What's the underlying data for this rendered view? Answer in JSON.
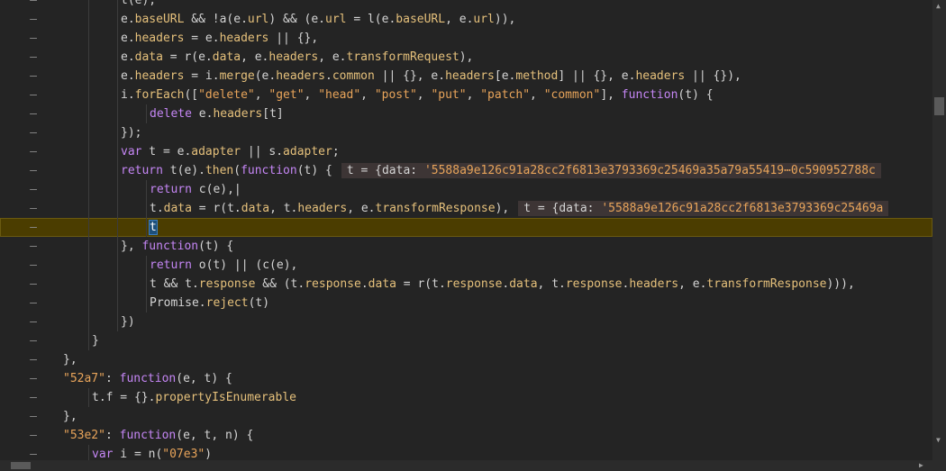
{
  "gutter_marker": "–",
  "highlight_line_index": 12,
  "colors": {
    "background": "#242424",
    "keyword": "#c586f5",
    "property": "#e5c07b",
    "string": "#e8a45a",
    "text": "#d4d4d4",
    "highlight": "#4b3d00"
  },
  "lines": [
    {
      "indent": 2,
      "tokens": [
        {
          "t": "t(e),",
          "c": "pl"
        }
      ]
    },
    {
      "indent": 2,
      "tokens": [
        {
          "t": "e.",
          "c": "pl"
        },
        {
          "t": "baseURL",
          "c": "pr"
        },
        {
          "t": " && !a(e.",
          "c": "pl"
        },
        {
          "t": "url",
          "c": "pr"
        },
        {
          "t": ") && (e.",
          "c": "pl"
        },
        {
          "t": "url",
          "c": "pr"
        },
        {
          "t": " = l(e.",
          "c": "pl"
        },
        {
          "t": "baseURL",
          "c": "pr"
        },
        {
          "t": ", e.",
          "c": "pl"
        },
        {
          "t": "url",
          "c": "pr"
        },
        {
          "t": ")),",
          "c": "pl"
        }
      ]
    },
    {
      "indent": 2,
      "tokens": [
        {
          "t": "e.",
          "c": "pl"
        },
        {
          "t": "headers",
          "c": "pr"
        },
        {
          "t": " = e.",
          "c": "pl"
        },
        {
          "t": "headers",
          "c": "pr"
        },
        {
          "t": " || {},",
          "c": "pl"
        }
      ]
    },
    {
      "indent": 2,
      "tokens": [
        {
          "t": "e.",
          "c": "pl"
        },
        {
          "t": "data",
          "c": "pr"
        },
        {
          "t": " = r(e.",
          "c": "pl"
        },
        {
          "t": "data",
          "c": "pr"
        },
        {
          "t": ", e.",
          "c": "pl"
        },
        {
          "t": "headers",
          "c": "pr"
        },
        {
          "t": ", e.",
          "c": "pl"
        },
        {
          "t": "transformRequest",
          "c": "pr"
        },
        {
          "t": "),",
          "c": "pl"
        }
      ]
    },
    {
      "indent": 2,
      "tokens": [
        {
          "t": "e.",
          "c": "pl"
        },
        {
          "t": "headers",
          "c": "pr"
        },
        {
          "t": " = i.",
          "c": "pl"
        },
        {
          "t": "merge",
          "c": "pr"
        },
        {
          "t": "(e.",
          "c": "pl"
        },
        {
          "t": "headers",
          "c": "pr"
        },
        {
          "t": ".",
          "c": "pl"
        },
        {
          "t": "common",
          "c": "pr"
        },
        {
          "t": " || {}, e.",
          "c": "pl"
        },
        {
          "t": "headers",
          "c": "pr"
        },
        {
          "t": "[e.",
          "c": "pl"
        },
        {
          "t": "method",
          "c": "pr"
        },
        {
          "t": "] || {}, e.",
          "c": "pl"
        },
        {
          "t": "headers",
          "c": "pr"
        },
        {
          "t": " || {}),",
          "c": "pl"
        }
      ]
    },
    {
      "indent": 2,
      "tokens": [
        {
          "t": "i.",
          "c": "pl"
        },
        {
          "t": "forEach",
          "c": "pr"
        },
        {
          "t": "([",
          "c": "pl"
        },
        {
          "t": "\"delete\"",
          "c": "st"
        },
        {
          "t": ", ",
          "c": "pl"
        },
        {
          "t": "\"get\"",
          "c": "st"
        },
        {
          "t": ", ",
          "c": "pl"
        },
        {
          "t": "\"head\"",
          "c": "st"
        },
        {
          "t": ", ",
          "c": "pl"
        },
        {
          "t": "\"post\"",
          "c": "st"
        },
        {
          "t": ", ",
          "c": "pl"
        },
        {
          "t": "\"put\"",
          "c": "st"
        },
        {
          "t": ", ",
          "c": "pl"
        },
        {
          "t": "\"patch\"",
          "c": "st"
        },
        {
          "t": ", ",
          "c": "pl"
        },
        {
          "t": "\"common\"",
          "c": "st"
        },
        {
          "t": "], ",
          "c": "pl"
        },
        {
          "t": "function",
          "c": "kw"
        },
        {
          "t": "(t) {",
          "c": "pl"
        }
      ]
    },
    {
      "indent": 3,
      "tokens": [
        {
          "t": "delete",
          "c": "kw"
        },
        {
          "t": " e.",
          "c": "pl"
        },
        {
          "t": "headers",
          "c": "pr"
        },
        {
          "t": "[t]",
          "c": "pl"
        }
      ]
    },
    {
      "indent": 2,
      "tokens": [
        {
          "t": "});",
          "c": "pl"
        }
      ]
    },
    {
      "indent": 2,
      "tokens": [
        {
          "t": "var",
          "c": "kw"
        },
        {
          "t": " t = e.",
          "c": "pl"
        },
        {
          "t": "adapter",
          "c": "pr"
        },
        {
          "t": " || s.",
          "c": "pl"
        },
        {
          "t": "adapter",
          "c": "pr"
        },
        {
          "t": ";",
          "c": "pl"
        }
      ]
    },
    {
      "indent": 2,
      "tokens": [
        {
          "t": "return",
          "c": "kw"
        },
        {
          "t": " t(e).",
          "c": "pl"
        },
        {
          "t": "then",
          "c": "pr"
        },
        {
          "t": "(",
          "c": "pl"
        },
        {
          "t": "function",
          "c": "kw"
        },
        {
          "t": "(t) {",
          "c": "pl"
        }
      ],
      "inline": {
        "prefix": "t = {data: ",
        "value": "'5588a9e126c91a28cc2f6813e3793369c25469a35a79a55419⋯0c590952788c"
      }
    },
    {
      "indent": 3,
      "tokens": [
        {
          "t": "return",
          "c": "kw"
        },
        {
          "t": " c(e),|",
          "c": "pl"
        }
      ]
    },
    {
      "indent": 3,
      "tokens": [
        {
          "t": "t.",
          "c": "pl"
        },
        {
          "t": "data",
          "c": "pr"
        },
        {
          "t": " = r(t.",
          "c": "pl"
        },
        {
          "t": "data",
          "c": "pr"
        },
        {
          "t": ", t.",
          "c": "pl"
        },
        {
          "t": "headers",
          "c": "pr"
        },
        {
          "t": ", e.",
          "c": "pl"
        },
        {
          "t": "transformResponse",
          "c": "pr"
        },
        {
          "t": "),",
          "c": "pl"
        }
      ],
      "inline": {
        "prefix": "t = {data: ",
        "value": "'5588a9e126c91a28cc2f6813e3793369c25469a"
      }
    },
    {
      "indent": 3,
      "tokens": [
        {
          "t": "t",
          "c": "cur"
        }
      ]
    },
    {
      "indent": 2,
      "tokens": [
        {
          "t": "}, ",
          "c": "pl"
        },
        {
          "t": "function",
          "c": "kw"
        },
        {
          "t": "(t) {",
          "c": "pl"
        }
      ]
    },
    {
      "indent": 3,
      "tokens": [
        {
          "t": "return",
          "c": "kw"
        },
        {
          "t": " o(t) || (c(e),",
          "c": "pl"
        }
      ]
    },
    {
      "indent": 3,
      "tokens": [
        {
          "t": "t && t.",
          "c": "pl"
        },
        {
          "t": "response",
          "c": "pr"
        },
        {
          "t": " && (t.",
          "c": "pl"
        },
        {
          "t": "response",
          "c": "pr"
        },
        {
          "t": ".",
          "c": "pl"
        },
        {
          "t": "data",
          "c": "pr"
        },
        {
          "t": " = r(t.",
          "c": "pl"
        },
        {
          "t": "response",
          "c": "pr"
        },
        {
          "t": ".",
          "c": "pl"
        },
        {
          "t": "data",
          "c": "pr"
        },
        {
          "t": ", t.",
          "c": "pl"
        },
        {
          "t": "response",
          "c": "pr"
        },
        {
          "t": ".",
          "c": "pl"
        },
        {
          "t": "headers",
          "c": "pr"
        },
        {
          "t": ", e.",
          "c": "pl"
        },
        {
          "t": "transformResponse",
          "c": "pr"
        },
        {
          "t": "))),",
          "c": "pl"
        }
      ]
    },
    {
      "indent": 3,
      "tokens": [
        {
          "t": "Promise.",
          "c": "pl"
        },
        {
          "t": "reject",
          "c": "pr"
        },
        {
          "t": "(t)",
          "c": "pl"
        }
      ]
    },
    {
      "indent": 2,
      "tokens": [
        {
          "t": "})",
          "c": "pl"
        }
      ]
    },
    {
      "indent": 1,
      "tokens": [
        {
          "t": "}",
          "c": "pl"
        }
      ]
    },
    {
      "indent": 0,
      "tokens": [
        {
          "t": "},",
          "c": "pl"
        }
      ]
    },
    {
      "indent": 0,
      "tokens": [
        {
          "t": "\"52a7\"",
          "c": "st"
        },
        {
          "t": ": ",
          "c": "pl"
        },
        {
          "t": "function",
          "c": "kw"
        },
        {
          "t": "(e, t) {",
          "c": "pl"
        }
      ]
    },
    {
      "indent": 1,
      "tokens": [
        {
          "t": "t.f = {}.",
          "c": "pl"
        },
        {
          "t": "propertyIsEnumerable",
          "c": "pr"
        }
      ]
    },
    {
      "indent": 0,
      "tokens": [
        {
          "t": "},",
          "c": "pl"
        }
      ]
    },
    {
      "indent": 0,
      "tokens": [
        {
          "t": "\"53e2\"",
          "c": "st"
        },
        {
          "t": ": ",
          "c": "pl"
        },
        {
          "t": "function",
          "c": "kw"
        },
        {
          "t": "(e, t, n) {",
          "c": "pl"
        }
      ]
    },
    {
      "indent": 1,
      "tokens": [
        {
          "t": "var",
          "c": "kw"
        },
        {
          "t": " i = n(",
          "c": "pl"
        },
        {
          "t": "\"07e3\"",
          "c": "st"
        },
        {
          "t": ")",
          "c": "pl"
        }
      ]
    }
  ],
  "scrollbar": {
    "up_arrow": "▲",
    "down_arrow": "▼",
    "right_arrow": "▶"
  }
}
